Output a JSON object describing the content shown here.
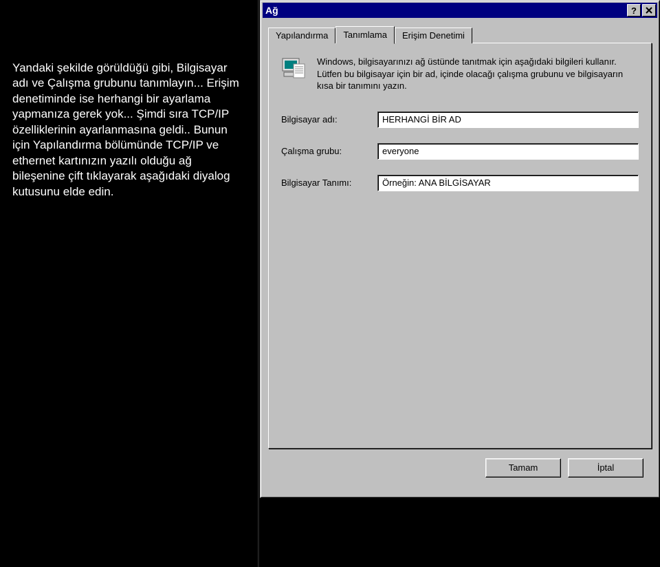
{
  "left_panel": {
    "text": "Yandaki şekilde görüldüğü gibi, Bilgisayar adı ve Çalışma grubunu tanımlayın... Erişim denetiminde ise herhangi bir ayarlama yapmanıza gerek yok... Şimdi sıra TCP/IP özelliklerinin ayarlanmasına geldi.. Bunun için Yapılandırma bölümünde TCP/IP ve ethernet kartınızın yazılı olduğu ağ bileşenine çift tıklayarak aşağıdaki diyalog kutusunu elde edin."
  },
  "dialog": {
    "title": "Ağ",
    "help_icon": "help-icon",
    "close_icon": "close-icon",
    "tabs": [
      {
        "label": "Yapılandırma",
        "active": false
      },
      {
        "label": "Tanımlama",
        "active": true
      },
      {
        "label": "Erişim Denetimi",
        "active": false
      }
    ],
    "info_text": "Windows, bilgisayarınızı ağ üstünde tanıtmak için aşağıdaki bilgileri kullanır. Lütfen bu bilgisayar için bir ad, içinde olacağı çalışma grubunu ve bilgisayarın kısa bir tanımını yazın.",
    "fields": {
      "computer_name": {
        "label": "Bilgisayar adı:",
        "value": "HERHANGİ BİR AD"
      },
      "workgroup": {
        "label": "Çalışma grubu:",
        "value": "everyone"
      },
      "description": {
        "label": "Bilgisayar Tanımı:",
        "value": "Örneğin: ANA BİLGİSAYAR"
      }
    },
    "buttons": {
      "ok": "Tamam",
      "cancel": "İptal"
    }
  }
}
